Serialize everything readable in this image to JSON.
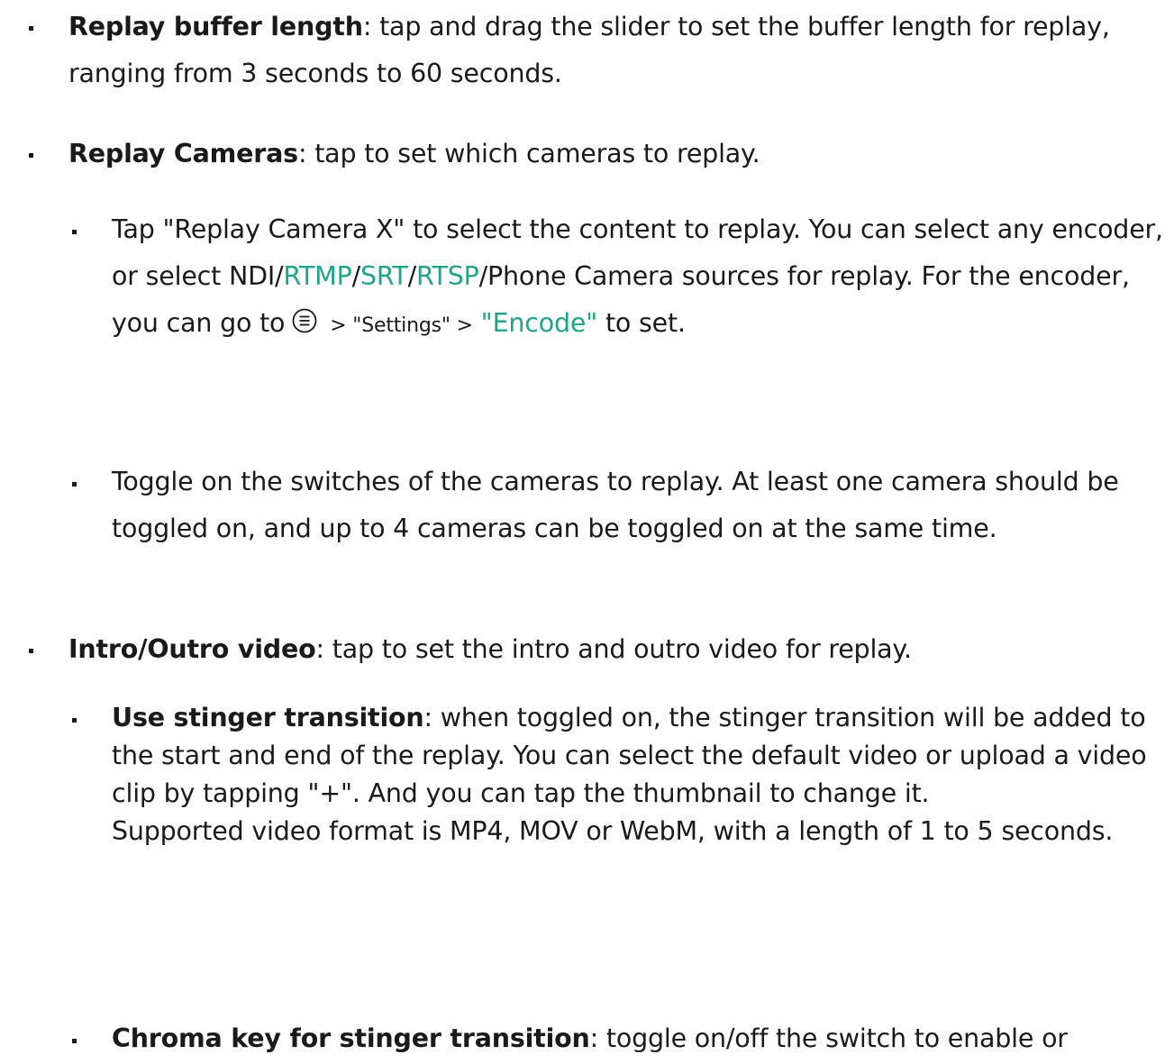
{
  "items": {
    "buffer": {
      "term": "Replay buffer length",
      "text": ": tap and drag the slider to set the buffer length for replay, ranging from 3 seconds to 60 seconds."
    },
    "cameras": {
      "term": "Replay Cameras",
      "text": ": tap to set which cameras to replay.",
      "sub1": {
        "t1": "Tap \"Replay Camera X\" to select the content to replay. You can select any encoder, or select NDI/",
        "rtmp": "RTMP",
        "slash1": "/",
        "srt": "SRT",
        "slash2": "/",
        "rtsp": "RTSP",
        "t2": "/Phone Camera sources for replay. For the encoder, you can go to",
        "menu_icon": "menu-circle-icon",
        "t3": "> \"Settings\" >",
        "encode": "\"Encode\"",
        "t4": "to set."
      },
      "sub2": {
        "text": "Toggle on the switches of the cameras to replay. At least one camera should be toggled on, and up to 4 cameras can be toggled on at the same time."
      }
    },
    "intro": {
      "term": "Intro/Outro video",
      "text": ": tap to set the intro and outro video for replay.",
      "sub1": {
        "term": "Use stinger transition",
        "text": ": when toggled on, the stinger transition will be added to the start and end of the replay. You can select the default video or upload a video clip by tapping \"+\". And you can tap the thumbnail to change it.",
        "text2": "Supported video format is MP4, MOV or WebM, with a length of 1 to 5 seconds."
      },
      "sub2": {
        "term": "Chroma key for stinger transition",
        "text": ": toggle on/off the switch to enable or"
      }
    }
  },
  "colors": {
    "link": "#1fa38a",
    "text": "#1a1a1a"
  }
}
